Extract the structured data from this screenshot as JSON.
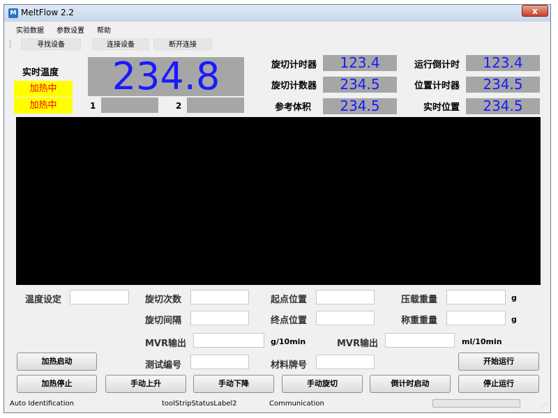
{
  "window": {
    "title": "MeltFlow 2.2",
    "close_label": "x"
  },
  "menu": [
    "实验数据",
    "参数设置",
    "帮助"
  ],
  "toolbar": [
    "寻找设备",
    "连接设备",
    "断开连接"
  ],
  "temperature": {
    "label": "实时温度",
    "status1": "加热中",
    "status2": "加热中",
    "value": "234.8",
    "slot1_label": "1",
    "slot2_label": "2"
  },
  "readouts": {
    "cut_timer_label": "旋切计时器",
    "cut_timer_value": "123.4",
    "countdown_label": "运行倒计时",
    "countdown_value": "123.4",
    "cut_counter_label": "旋切计数器",
    "cut_counter_value": "234.5",
    "position_counter_label": "位置计时器",
    "position_counter_value": "234.5",
    "ref_volume_label": "参考体积",
    "ref_volume_value": "234.5",
    "real_position_label": "实时位置",
    "real_position_value": "234.5"
  },
  "form": {
    "temp_setting": "温度设定",
    "cut_times": "旋切次数",
    "start_position": "起点位置",
    "load_weight": "压载重量",
    "load_weight_unit": "g",
    "cut_interval": "旋切间隔",
    "end_position": "终点位置",
    "weigh_weight": "称重重量",
    "weigh_weight_unit": "g",
    "mvr_output1": "MVR输出",
    "mvr_output1_unit": "g/10min",
    "mvr_output2": "MVR输出",
    "mvr_output2_unit": "ml/10min",
    "test_number": "测试编号",
    "material_grade": "材料牌号"
  },
  "buttons": {
    "heat_start": "加热启动",
    "start_run": "开始运行",
    "heat_stop": "加热停止",
    "manual_up": "手动上升",
    "manual_down": "手动下降",
    "manual_cut": "手动旋切",
    "countdown_start": "倒计时启动",
    "stop_run": "停止运行"
  },
  "status": {
    "label1": "Auto Identification",
    "label2": "toolStripStatusLabel2",
    "label3": "Communication"
  },
  "colors": {
    "value_blue": "#1a1aff",
    "heating_bg": "#ffff00",
    "heating_text": "#ff0000",
    "graph_bg": "#000000"
  }
}
